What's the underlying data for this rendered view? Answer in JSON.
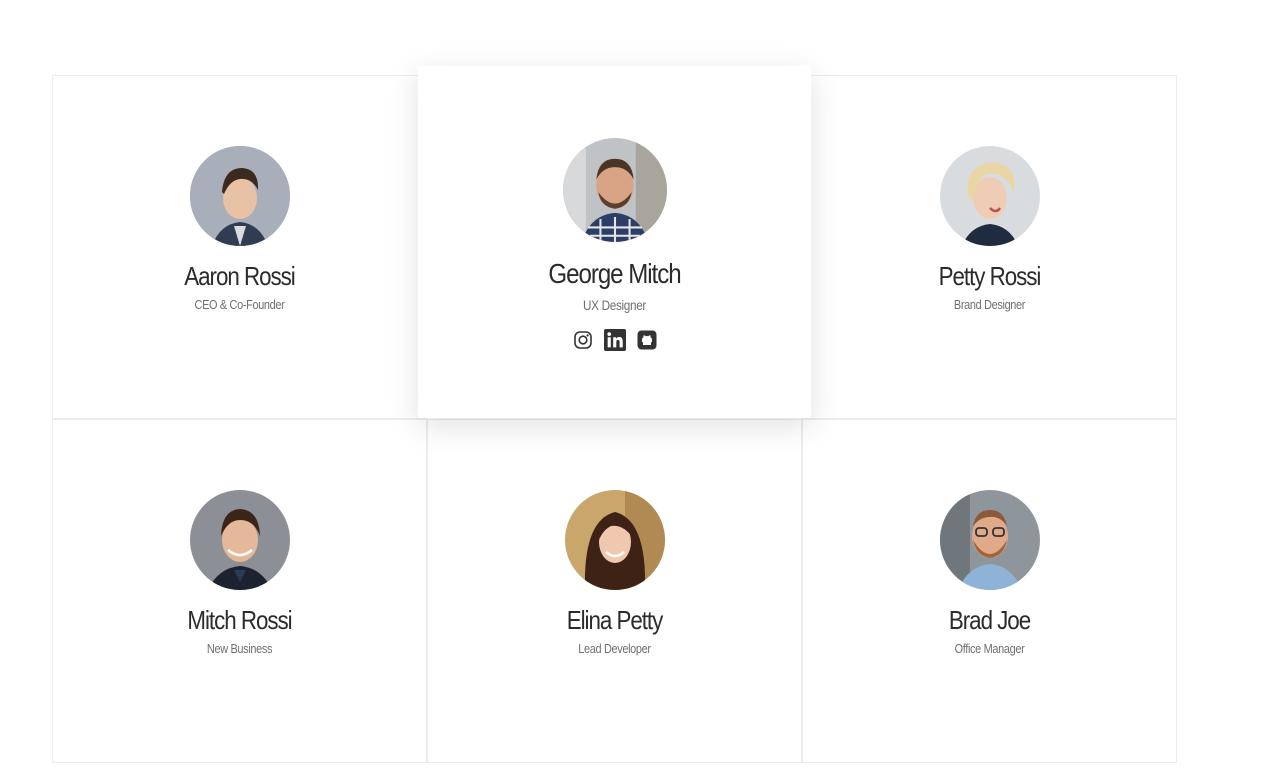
{
  "team": [
    {
      "name": "Aaron Rossi",
      "role": "CEO & Co-Founder"
    },
    {
      "name": "George Mitch",
      "role": "UX Designer",
      "active": true
    },
    {
      "name": "Petty Rossi",
      "role": "Brand Designer"
    },
    {
      "name": "Mitch Rossi",
      "role": "New Business"
    },
    {
      "name": "Elina Petty",
      "role": "Lead Developer"
    },
    {
      "name": "Brad Joe",
      "role": "Office Manager"
    }
  ],
  "social_icons": [
    "instagram-icon",
    "linkedin-icon",
    "github-icon"
  ],
  "colors": {
    "text": "#2b2b2b",
    "muted": "#6f6f6f",
    "border": "#ececec",
    "icon": "#333333"
  }
}
